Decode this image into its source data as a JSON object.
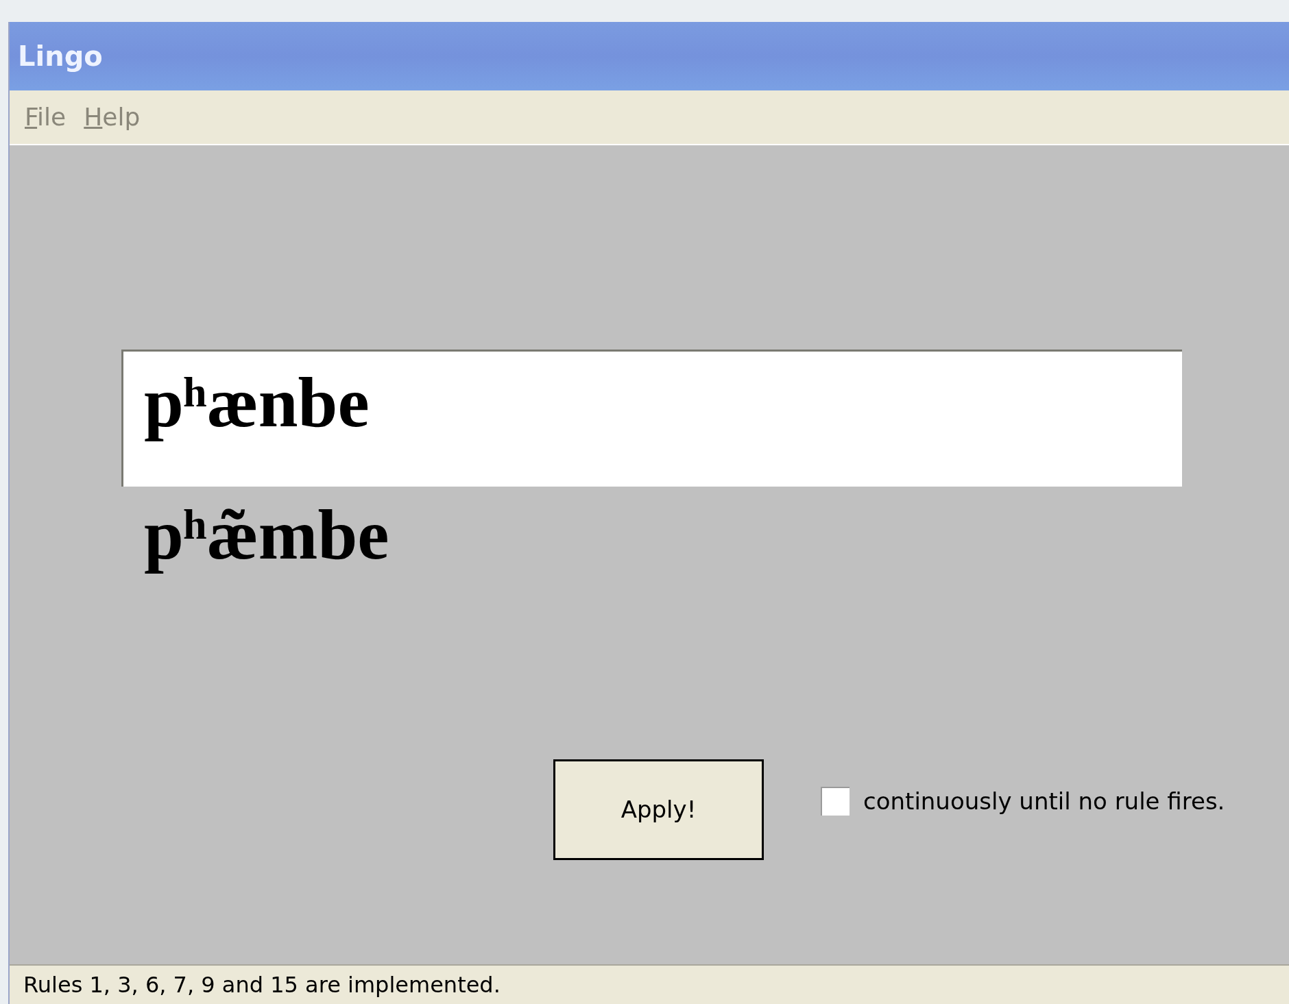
{
  "window": {
    "title": "Lingo"
  },
  "menu": [
    {
      "label": "File"
    },
    {
      "label": "Help"
    }
  ],
  "input": {
    "value": "pʰænbe"
  },
  "output": "pʰæ̃mbe",
  "apply_button": "Apply!",
  "continuous": {
    "label": "continuously until no rule fires.",
    "checked": false
  },
  "status_bar": "Rules 1, 3, 6, 7, 9 and 15 are implemented."
}
